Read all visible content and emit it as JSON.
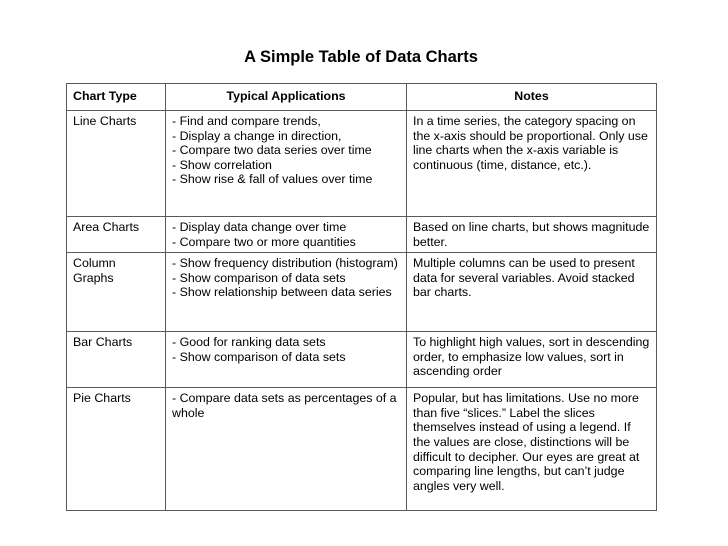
{
  "title": "A Simple Table of Data Charts",
  "headers": {
    "chart_type": "Chart Type",
    "applications": "Typical Applications",
    "notes": "Notes"
  },
  "rows": [
    {
      "chart_type": "Line Charts",
      "applications": [
        "- Find and compare trends,",
        "- Display a change in direction,",
        "- Compare two data series over time",
        "- Show correlation",
        "- Show rise & fall of values over time"
      ],
      "notes": "In a time series, the category spacing on the x-axis should be proportional. Only use line charts when the x-axis variable is continuous (time, distance, etc.)."
    },
    {
      "chart_type": "Area Charts",
      "applications": [
        "- Display data change over time",
        "- Compare two or more quantities"
      ],
      "notes": "Based on line charts, but shows magnitude better."
    },
    {
      "chart_type": "Column Graphs",
      "applications": [
        "- Show frequency distribution (histogram)",
        "- Show comparison of data sets",
        "- Show relationship between data series"
      ],
      "notes": "Multiple columns can be used to present data for several variables. Avoid stacked bar charts."
    },
    {
      "chart_type": "Bar Charts",
      "applications": [
        "- Good for ranking data sets",
        "- Show comparison of data sets"
      ],
      "notes": "To highlight high values, sort in descending order, to emphasize low values, sort in ascending order"
    },
    {
      "chart_type": "Pie Charts",
      "applications": [
        "- Compare data sets as percentages of a whole"
      ],
      "notes": "Popular, but has limitations.  Use no more than five “slices.”  Label the slices themselves instead of using a legend. If the values are close, distinctions will be difficult to decipher. Our eyes are great at comparing line lengths, but can’t judge angles very well."
    }
  ]
}
